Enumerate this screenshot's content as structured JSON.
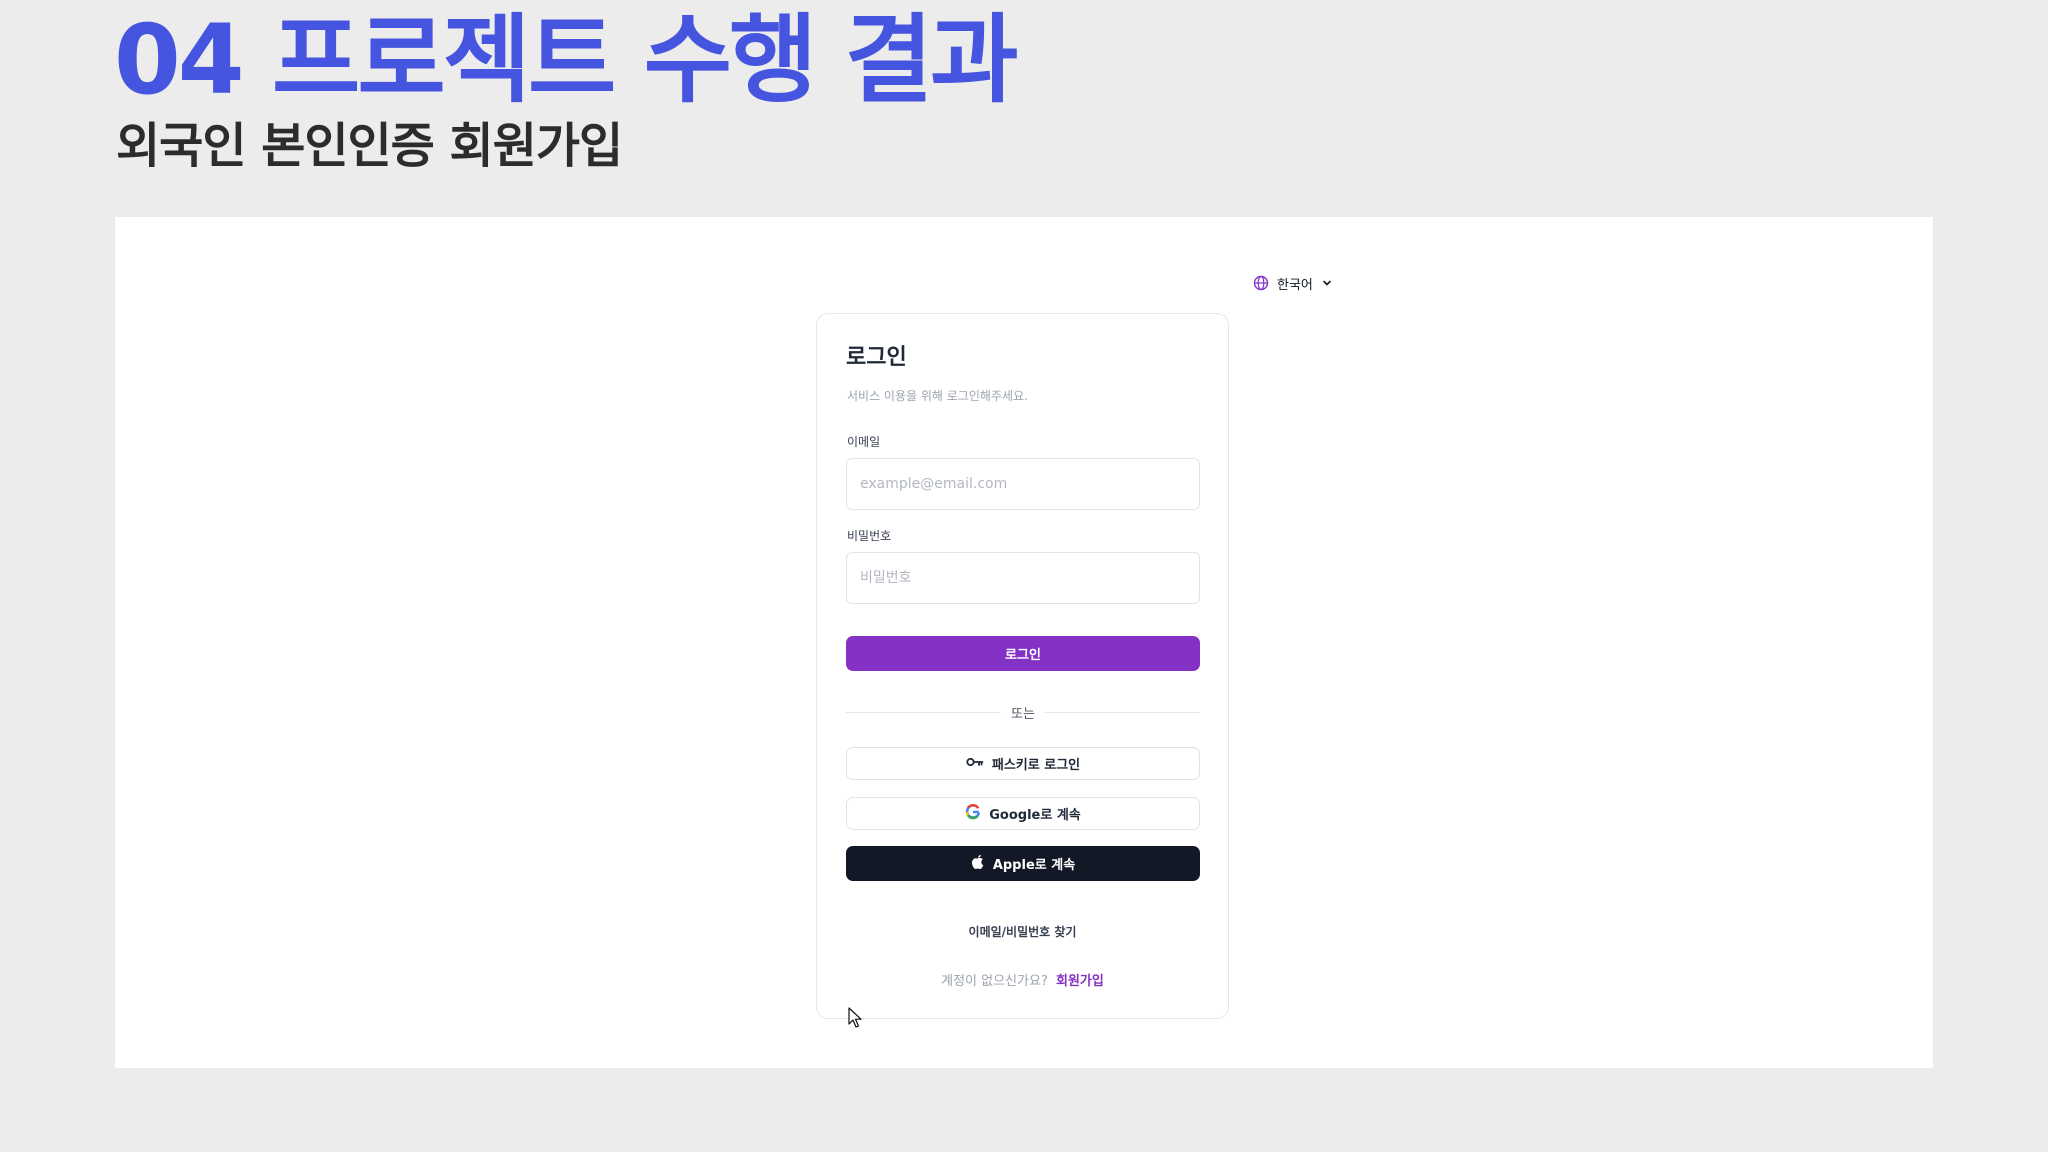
{
  "slide": {
    "title": "04 프로젝트 수행 결과",
    "subtitle": "외국인 본인인증 회원가입"
  },
  "language_selector": {
    "icon": "globe-icon",
    "label": "한국어",
    "chevron_icon": "chevron-down-icon"
  },
  "login": {
    "title": "로그인",
    "subtitle": "서비스 이용을 위해 로그인해주세요.",
    "email_label": "이메일",
    "email_placeholder": "example@email.com",
    "email_value": "",
    "password_label": "비밀번호",
    "password_placeholder": "비밀번호",
    "password_value": "",
    "submit_label": "로그인",
    "divider_text": "또는",
    "passkey_label": "패스키로 로그인",
    "google_label": "Google로 계속",
    "apple_label": "Apple로 계속",
    "find_account_label": "이메일/비밀번호 찾기",
    "signup_prompt": "계정이 없으신가요?",
    "signup_link": "회원가입"
  },
  "colors": {
    "title_blue": "#4655df",
    "primary_purple": "#8431c6",
    "apple_dark": "#121826",
    "slide_background": "#ececec"
  }
}
